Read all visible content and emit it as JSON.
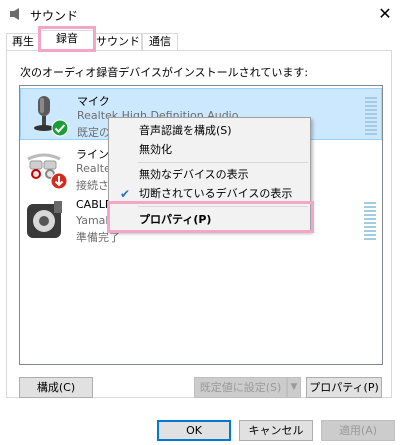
{
  "window": {
    "title": "サウンド",
    "close_glyph": "✕",
    "icon": "speaker-icon"
  },
  "tabs": [
    {
      "label": "再生"
    },
    {
      "label": "録音",
      "active": true
    },
    {
      "label": "サウンド"
    },
    {
      "label": "通信"
    }
  ],
  "instruction": "次のオーディオ録音デバイスがインストールされています:",
  "devices": [
    {
      "name": "マイク",
      "driver": "Realtek High Definition Audio",
      "status": "既定のデバイス",
      "icon": "microphone-icon",
      "badge": "default-check-icon",
      "selected": true
    },
    {
      "name": "ライン入力",
      "driver": "Realtek High Definition Audio",
      "status": "接続されていません",
      "icon": "line-in-icon",
      "badge": "unplugged-icon",
      "selected": false
    },
    {
      "name": "CABLE Output",
      "driver": "Yamaha SYNCROOM Driver",
      "status": "準備完了",
      "icon": "cable-icon",
      "badge": "",
      "selected": false
    }
  ],
  "context_menu": {
    "items": [
      {
        "label": "音声認識を構成(S)"
      },
      {
        "label": "無効化"
      },
      {
        "label": "無効なデバイスの表示"
      },
      {
        "label": "切断されているデバイスの表示",
        "checked": true
      },
      {
        "label": "プロパティ(P)",
        "bold": true
      }
    ]
  },
  "bottom_buttons": {
    "configure": "構成(C)",
    "set_default": "既定値に設定(S)",
    "properties": "プロパティ(P)"
  },
  "footer_buttons": {
    "ok": "OK",
    "cancel": "キャンセル",
    "apply": "適用(A)"
  },
  "colors": {
    "selection": "#cce8ff",
    "highlight_annotation": "#f4a6c6",
    "check_green": "#1e9c3a",
    "arrow_red": "#d52b1e"
  }
}
